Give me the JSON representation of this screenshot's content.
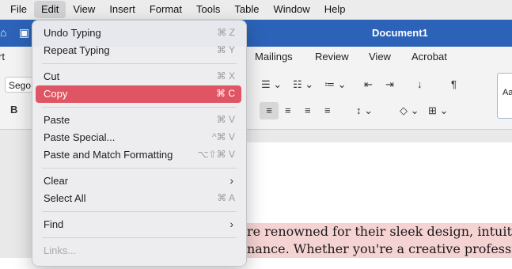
{
  "menubar": {
    "items": [
      "File",
      "Edit",
      "View",
      "Insert",
      "Format",
      "Tools",
      "Table",
      "Window",
      "Help"
    ],
    "active": "Edit"
  },
  "titlebar": {
    "title": "Document1"
  },
  "ribbon_tabs": {
    "left_partial": "rt",
    "items": [
      "Mailings",
      "Review",
      "View",
      "Acrobat"
    ]
  },
  "ribbon": {
    "font_name": "Sego",
    "bold": "B",
    "style_preview": "Aa"
  },
  "edit_menu": {
    "items": [
      {
        "label": "Undo Typing",
        "shortcut": "⌘ Z"
      },
      {
        "label": "Repeat Typing",
        "shortcut": "⌘ Y"
      },
      {
        "label": "Cut",
        "shortcut": "⌘ X"
      },
      {
        "label": "Copy",
        "shortcut": "⌘ C",
        "highlighted": true
      },
      {
        "label": "Paste",
        "shortcut": "⌘ V"
      },
      {
        "label": "Paste Special...",
        "shortcut": "^⌘ V"
      },
      {
        "label": "Paste and Match Formatting",
        "shortcut": "⌥⇧⌘ V"
      },
      {
        "label": "Clear",
        "submenu": true
      },
      {
        "label": "Select All",
        "shortcut": "⌘ A"
      },
      {
        "label": "Find",
        "submenu": true
      },
      {
        "label": "Links...",
        "disabled": true
      }
    ]
  },
  "document": {
    "line1": "re renowned for their sleek design, intuitive u",
    "line2": "nance. Whether you're a creative professional w"
  }
}
